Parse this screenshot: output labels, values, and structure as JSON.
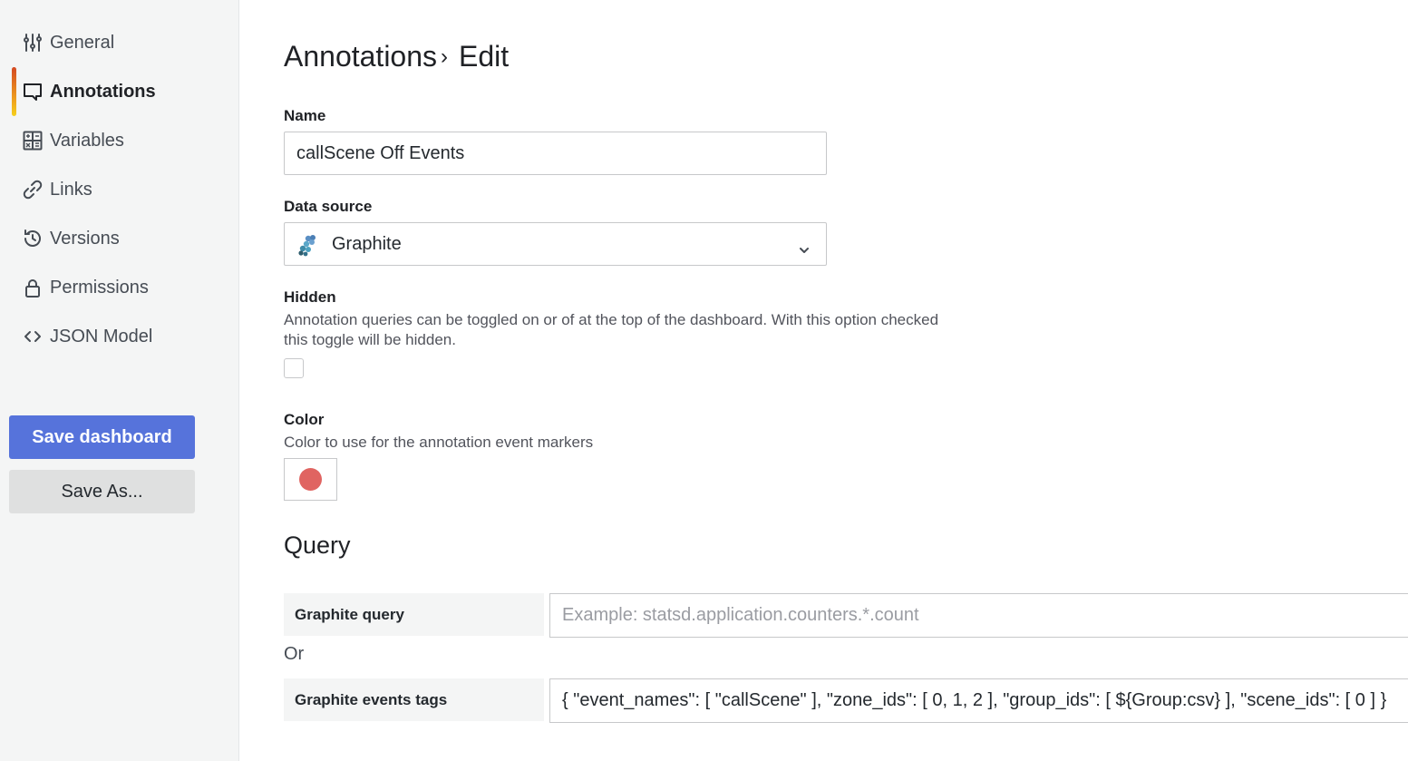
{
  "sidebar": {
    "items": [
      {
        "label": "General",
        "icon": "sliders-icon",
        "active": false
      },
      {
        "label": "Annotations",
        "icon": "comment-icon",
        "active": true
      },
      {
        "label": "Variables",
        "icon": "calculator-icon",
        "active": false
      },
      {
        "label": "Links",
        "icon": "link-icon",
        "active": false
      },
      {
        "label": "Versions",
        "icon": "history-icon",
        "active": false
      },
      {
        "label": "Permissions",
        "icon": "lock-icon",
        "active": false
      },
      {
        "label": "JSON Model",
        "icon": "code-brackets-icon",
        "active": false
      }
    ],
    "save_label": "Save dashboard",
    "save_as_label": "Save As..."
  },
  "header": {
    "breadcrumb_parent": "Annotations",
    "breadcrumb_separator": "›",
    "breadcrumb_current": "Edit"
  },
  "form": {
    "name_label": "Name",
    "name_value": "callScene Off Events",
    "datasource_label": "Data source",
    "datasource_value": "Graphite",
    "hidden_label": "Hidden",
    "hidden_desc": "Annotation queries can be toggled on or of at the top of the dashboard. With this option checked this toggle will be hidden.",
    "hidden_checked": false,
    "color_label": "Color",
    "color_desc": "Color to use for the annotation event markers",
    "color_value": "#e06461"
  },
  "query": {
    "title": "Query",
    "graphite_query_label": "Graphite query",
    "graphite_query_placeholder": "Example: statsd.application.counters.*.count",
    "graphite_query_value": "",
    "or_label": "Or",
    "events_tags_label": "Graphite events tags",
    "events_tags_value": "{ \"event_names\": [ \"callScene\" ], \"zone_ids\": [ 0, 1, 2 ], \"group_ids\": [ ${Group:csv} ], \"scene_ids\": [ 0 ] }"
  },
  "colors": {
    "primary": "#5673db",
    "active_gradient_top": "#d44a22",
    "active_gradient_bottom": "#f5d01c"
  }
}
